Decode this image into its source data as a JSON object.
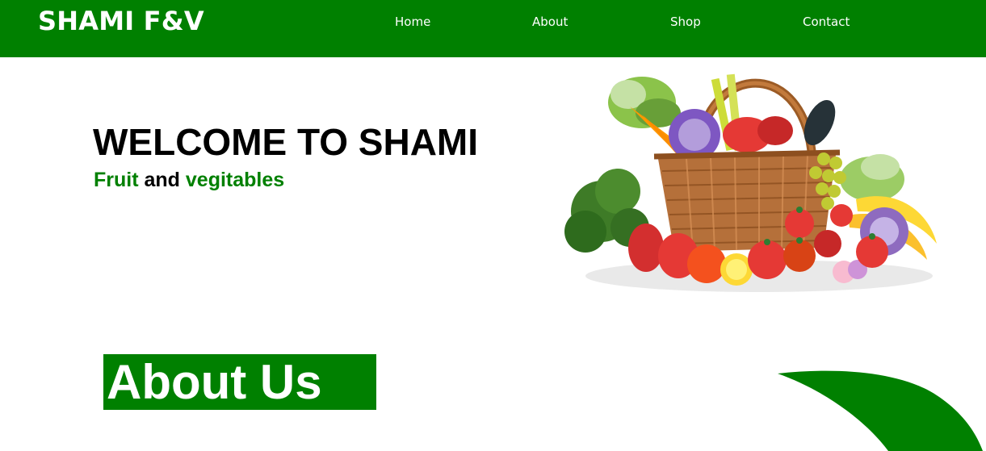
{
  "header": {
    "brand": "SHAMI F&V",
    "nav": [
      {
        "label": "Home"
      },
      {
        "label": "About"
      },
      {
        "label": "Shop"
      },
      {
        "label": "Contact"
      }
    ]
  },
  "hero": {
    "title": "WELCOME TO SHAMI",
    "subtitle_parts": [
      "Fruit",
      " and ",
      "vegitables"
    ]
  },
  "about": {
    "title": "About Us"
  },
  "colors": {
    "brand_green": "#008000",
    "text_dark": "#000000",
    "text_light": "#ffffff"
  },
  "icons": {
    "hero_image": "vegetable-basket-image",
    "decoration": "green-leaf-shape"
  }
}
